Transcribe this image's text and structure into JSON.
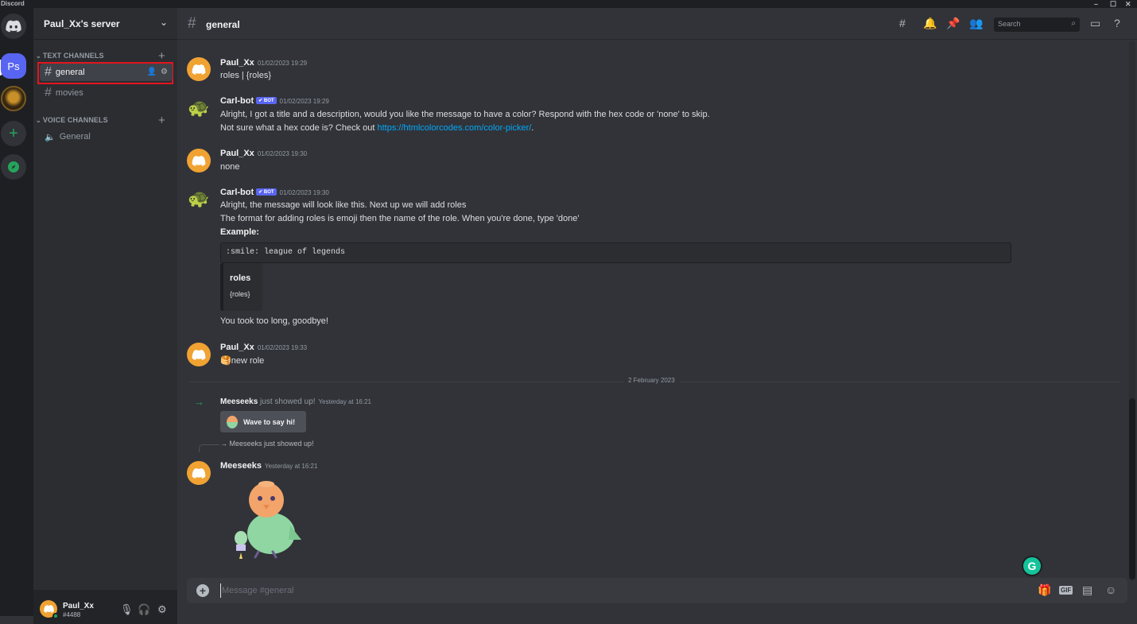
{
  "app": {
    "title": "Discord",
    "window_controls": [
      "–",
      "☐",
      "✕"
    ]
  },
  "guilds": {
    "ps_label": "Ps",
    "add_symbol": "+"
  },
  "server": {
    "name": "Paul_Xx's server"
  },
  "sidebar": {
    "text_category": "TEXT CHANNELS",
    "voice_category": "VOICE CHANNELS",
    "text_channels": [
      {
        "name": "general",
        "active": true
      },
      {
        "name": "movies",
        "active": false
      }
    ],
    "voice_channels": [
      {
        "name": "General"
      }
    ]
  },
  "user": {
    "name": "Paul_Xx",
    "tag": "#4488"
  },
  "channel_header": {
    "name": "general",
    "search_placeholder": "Search"
  },
  "messages": [
    {
      "author": "Paul_Xx",
      "timestamp": "01/02/2023 19:29",
      "lines": [
        "roles | {roles}"
      ]
    },
    {
      "author": "Carl-bot",
      "bot_tag": "✔ BOT",
      "timestamp": "01/02/2023 19:29",
      "line1": "Alright, I got a title and a description, would you like the message to have a color? Respond with the hex code or 'none' to skip.",
      "line2_prefix": "Not sure what a hex code is? Check out ",
      "line2_link": "https://htmlcolorcodes.com/color-picker/",
      "line2_suffix": "."
    },
    {
      "author": "Paul_Xx",
      "timestamp": "01/02/2023 19:30",
      "lines": [
        "none"
      ]
    },
    {
      "author": "Carl-bot",
      "bot_tag": "✔ BOT",
      "timestamp": "01/02/2023 19:30",
      "line1": "Alright, the message will look like this. Next up we will add roles",
      "line2": "The format for adding roles is emoji then the name of the role. When you're done, type 'done'",
      "example_label": "Example:",
      "code": ":smile: league of legends",
      "embed_title": "roles",
      "embed_desc": "{roles}",
      "line_after": "You took too long, goodbye!"
    },
    {
      "author": "Paul_Xx",
      "timestamp": "01/02/2023 19:33",
      "emoji": "🥞",
      "text": "new role"
    }
  ],
  "date_divider": "2 February 2023",
  "join": {
    "user": "Meeseeks",
    "text": "just showed up!",
    "timestamp": "Yesterday at 16:21",
    "button": "Wave to say hi!"
  },
  "reply_message": {
    "reply_ref": "→ Meeseeks just showed up!",
    "author": "Meeseeks",
    "timestamp": "Yesterday at 16:21"
  },
  "composer": {
    "placeholder": "Message #general",
    "gif_label": "GIF"
  },
  "colors": {
    "accent": "#5865f2",
    "online": "#23a55a",
    "highlight": "#e4151f",
    "link": "#00a8fc"
  }
}
